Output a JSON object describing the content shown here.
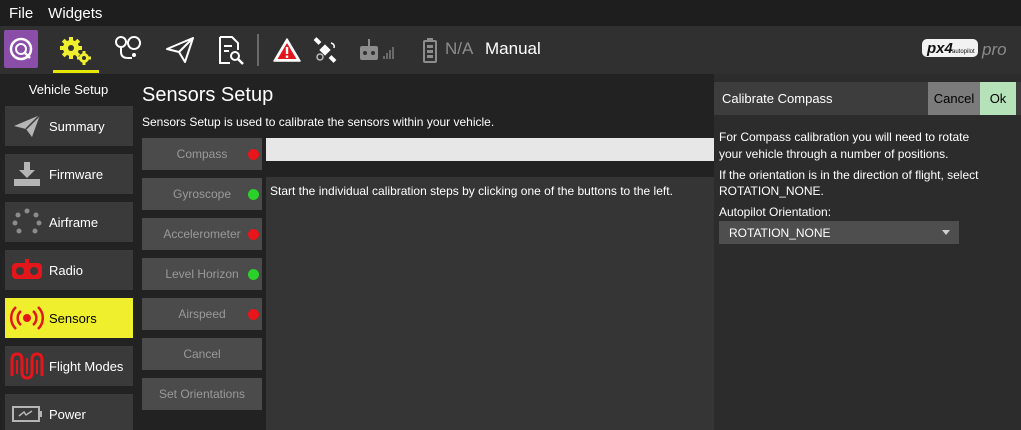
{
  "menu": {
    "file": "File",
    "widgets": "Widgets"
  },
  "toolbar": {
    "status_na": "N/A",
    "flight_mode": "Manual",
    "brand": "pro",
    "brand_logo_text": "px4 autopilot",
    "accent_color": "#f0ef2e"
  },
  "sidebar": {
    "title": "Vehicle Setup",
    "items": [
      {
        "label": "Summary",
        "icon": "paper-plane-icon"
      },
      {
        "label": "Firmware",
        "icon": "download-icon"
      },
      {
        "label": "Airframe",
        "icon": "airframe-dots-icon"
      },
      {
        "label": "Radio",
        "icon": "radio-icon"
      },
      {
        "label": "Sensors",
        "icon": "sensor-wave-icon",
        "active": true
      },
      {
        "label": "Flight Modes",
        "icon": "flight-modes-icon"
      },
      {
        "label": "Power",
        "icon": "battery-icon"
      }
    ]
  },
  "main": {
    "title": "Sensors Setup",
    "description": "Sensors Setup is used to calibrate the sensors within your vehicle.",
    "instructions": "Start the individual calibration steps by clicking one of the buttons to the left.",
    "buttons": [
      {
        "label": "Compass",
        "status": "red"
      },
      {
        "label": "Gyroscope",
        "status": "green"
      },
      {
        "label": "Accelerometer",
        "status": "red"
      },
      {
        "label": "Level Horizon",
        "status": "green"
      },
      {
        "label": "Airspeed",
        "status": "red"
      },
      {
        "label": "Cancel"
      },
      {
        "label": "Set Orientations"
      }
    ],
    "status_colors": {
      "red": "#e8151b",
      "green": "#2ad12a"
    }
  },
  "panel": {
    "title": "Calibrate Compass",
    "cancel": "Cancel",
    "ok": "Ok",
    "text1a": "For Compass calibration you will need to rotate",
    "text1b": "your vehicle through a number of positions.",
    "text2a": "If the orientation is in the direction of flight, select",
    "text2b": "ROTATION_NONE.",
    "orientation_label": "Autopilot Orientation:",
    "orientation_value": "ROTATION_NONE"
  }
}
